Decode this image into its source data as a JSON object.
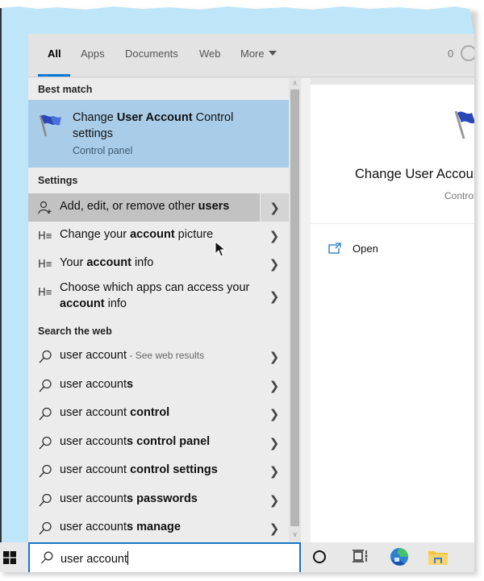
{
  "tabs": [
    {
      "label": "All",
      "active": true
    },
    {
      "label": "Apps",
      "active": false
    },
    {
      "label": "Documents",
      "active": false
    },
    {
      "label": "Web",
      "active": false
    },
    {
      "label": "More",
      "active": false
    }
  ],
  "points": "0",
  "sections": {
    "best_match": "Best match",
    "settings": "Settings",
    "search_web": "Search the web"
  },
  "best_match": {
    "title_pre": "Change ",
    "title_bold": "User Account",
    "title_post": " Control settings",
    "subtitle": "Control panel",
    "icon": "uac-flag-icon"
  },
  "settings_items": [
    {
      "pre": "Add, edit, or remove other ",
      "bold": "users",
      "post": "",
      "icon": "add-user-icon",
      "hover": true
    },
    {
      "pre": "Change your ",
      "bold": "account",
      "post": " picture",
      "icon": "user-list-icon"
    },
    {
      "pre": "Your ",
      "bold": "account",
      "post": " info",
      "icon": "user-list-icon"
    },
    {
      "pre": "Choose which apps can access your ",
      "bold": "account",
      "post": " info",
      "icon": "user-list-icon"
    }
  ],
  "web_items": [
    {
      "pre": "user account",
      "bold": "",
      "note": " - See web results"
    },
    {
      "pre": "user account",
      "bold": "s",
      "note": ""
    },
    {
      "pre": "user account ",
      "bold": "control",
      "note": ""
    },
    {
      "pre": "user account",
      "bold": "s control panel",
      "note": ""
    },
    {
      "pre": "user account ",
      "bold": "control settings",
      "note": ""
    },
    {
      "pre": "user account",
      "bold": "s passwords",
      "note": ""
    },
    {
      "pre": "user account",
      "bold": "s manage",
      "note": ""
    }
  ],
  "preview": {
    "title": "Change User Account Control settings",
    "subtitle": "Control panel",
    "open_label": "Open"
  },
  "search": {
    "value": "user account"
  },
  "colors": {
    "accent": "#0078d7",
    "best_match_bg": "#a9cde9",
    "hover_bg": "#c2c2c2"
  }
}
